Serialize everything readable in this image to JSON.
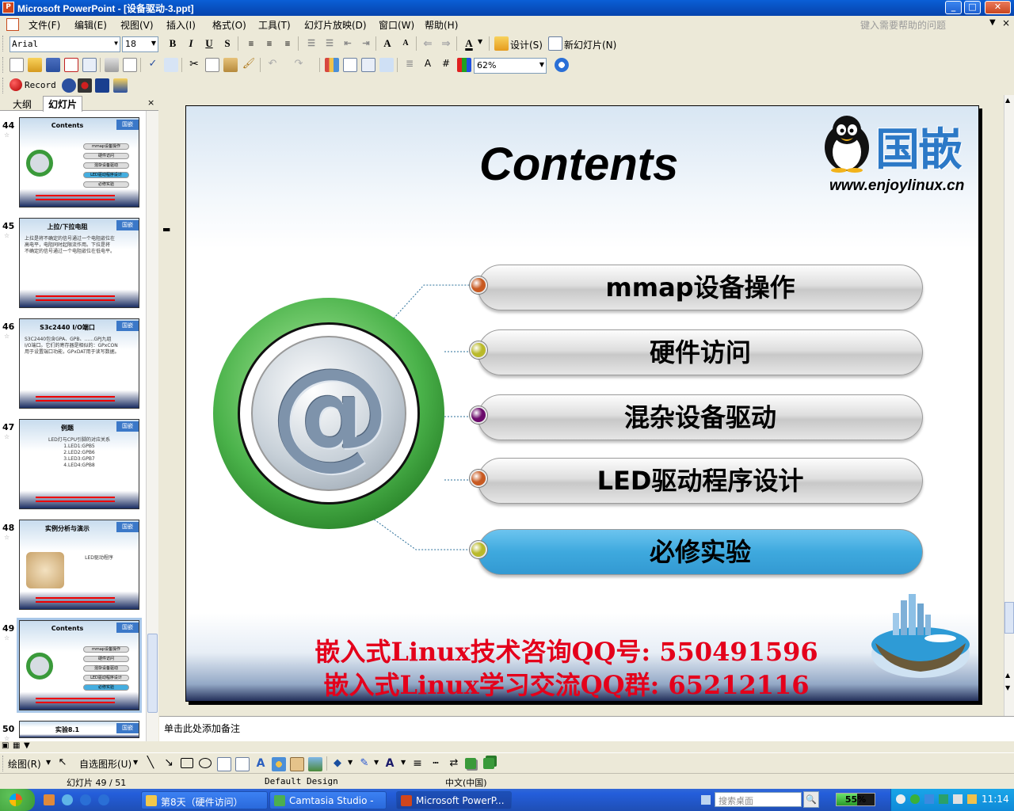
{
  "window": {
    "title": "Microsoft PowerPoint - [设备驱动-3.ppt]",
    "app_icon": "P"
  },
  "menubar": {
    "items": [
      "文件(F)",
      "编辑(E)",
      "视图(V)",
      "插入(I)",
      "格式(O)",
      "工具(T)",
      "幻灯片放映(D)",
      "窗口(W)",
      "帮助(H)"
    ],
    "help_placeholder": "键入需要帮助的问题"
  },
  "format_toolbar": {
    "font": "Arial",
    "size": "18",
    "design_label": "设计(S)",
    "new_slide_label": "新幻灯片(N)"
  },
  "standard_toolbar": {
    "zoom": "62%"
  },
  "record_toolbar": {
    "record_label": "Record"
  },
  "left_panel": {
    "tabs": [
      "大纲",
      "幻灯片"
    ],
    "active_tab": "幻灯片",
    "thumbnails": [
      {
        "num": "44",
        "title": "Contents",
        "kind": "contents",
        "items": [
          "mmap设备操作",
          "硬件访问",
          "混杂设备驱动",
          "LED驱动程序设计",
          "必修实验"
        ],
        "highlight": 3
      },
      {
        "num": "45",
        "title": "上拉/下拉电阻",
        "kind": "text",
        "lines": [
          "上拉是将不确定的信号通过一个电阻嵌位在",
          "高电平，电阻同时起限流作用。下拉是将",
          "不确定的信号通过一个电阻嵌位在低电平。"
        ]
      },
      {
        "num": "46",
        "title": "S3c2440 I/O端口",
        "kind": "text",
        "lines": [
          "S3C2440包含GPA、GPB、……GPJ九组",
          "I/O端口。它们的寄存器是相似的：GPxCON",
          "用于设置端口功能，GPxDAT用于读写数据。"
        ]
      },
      {
        "num": "47",
        "title": "例题",
        "kind": "list",
        "lines": [
          "LED灯与CPU引脚的对应关系",
          "1.LED1:GPB5",
          "2.LED2:GPB6",
          "3.LED3:GPB7",
          "4.LED4:GPB8"
        ]
      },
      {
        "num": "48",
        "title": "实例分析与演示",
        "kind": "image",
        "lines": [
          "LED驱动程序"
        ]
      },
      {
        "num": "49",
        "title": "Contents",
        "kind": "contents",
        "items": [
          "mmap设备操作",
          "硬件访问",
          "混杂设备驱动",
          "LED驱动程序设计",
          "必修实验"
        ],
        "highlight": 4
      },
      {
        "num": "50",
        "title": "实验8.1",
        "kind": "text",
        "lines": []
      }
    ],
    "selected": "49"
  },
  "slide": {
    "title": "Contents",
    "logo_text": "国嵌",
    "logo_url": "www.enjoylinux.cn",
    "items": [
      {
        "label": "mmap设备操作",
        "dot_color": "#c85a22",
        "active": false
      },
      {
        "label": "硬件访问",
        "dot_color": "#b9b92a",
        "active": false
      },
      {
        "label": "混杂设备驱动",
        "dot_color": "#6b0b6b",
        "active": false
      },
      {
        "label": "LED驱动程序设计",
        "dot_color": "#c85a22",
        "active": false
      },
      {
        "label": "必修实验",
        "dot_color": "#b9b92a",
        "active": true
      }
    ],
    "center_symbol": "@",
    "footer_lines": [
      "嵌入式Linux技术咨询QQ号: 550491596",
      "嵌入式Linux学习交流QQ群: 65212116"
    ]
  },
  "notes": {
    "placeholder": "单击此处添加备注"
  },
  "draw_toolbar": {
    "draw_label": "绘图(R)",
    "autoshape_label": "自选图形(U)"
  },
  "statusbar": {
    "slide_info": "幻灯片 49 / 51",
    "design": "Default Design",
    "language": "中文(中国)"
  },
  "taskbar": {
    "tasks": [
      {
        "label": "第8天（硬件访问）",
        "icon_color": "#f2c84b",
        "active": false
      },
      {
        "label": "Camtasia Studio - ...",
        "icon_color": "#4caf50",
        "active": false
      },
      {
        "label": "Microsoft PowerP...",
        "icon_color": "#d0461c",
        "active": true
      }
    ],
    "search_placeholder": "搜索桌面",
    "cpu_percent": 55,
    "cpu_label": "55%",
    "clock": "11:14"
  }
}
